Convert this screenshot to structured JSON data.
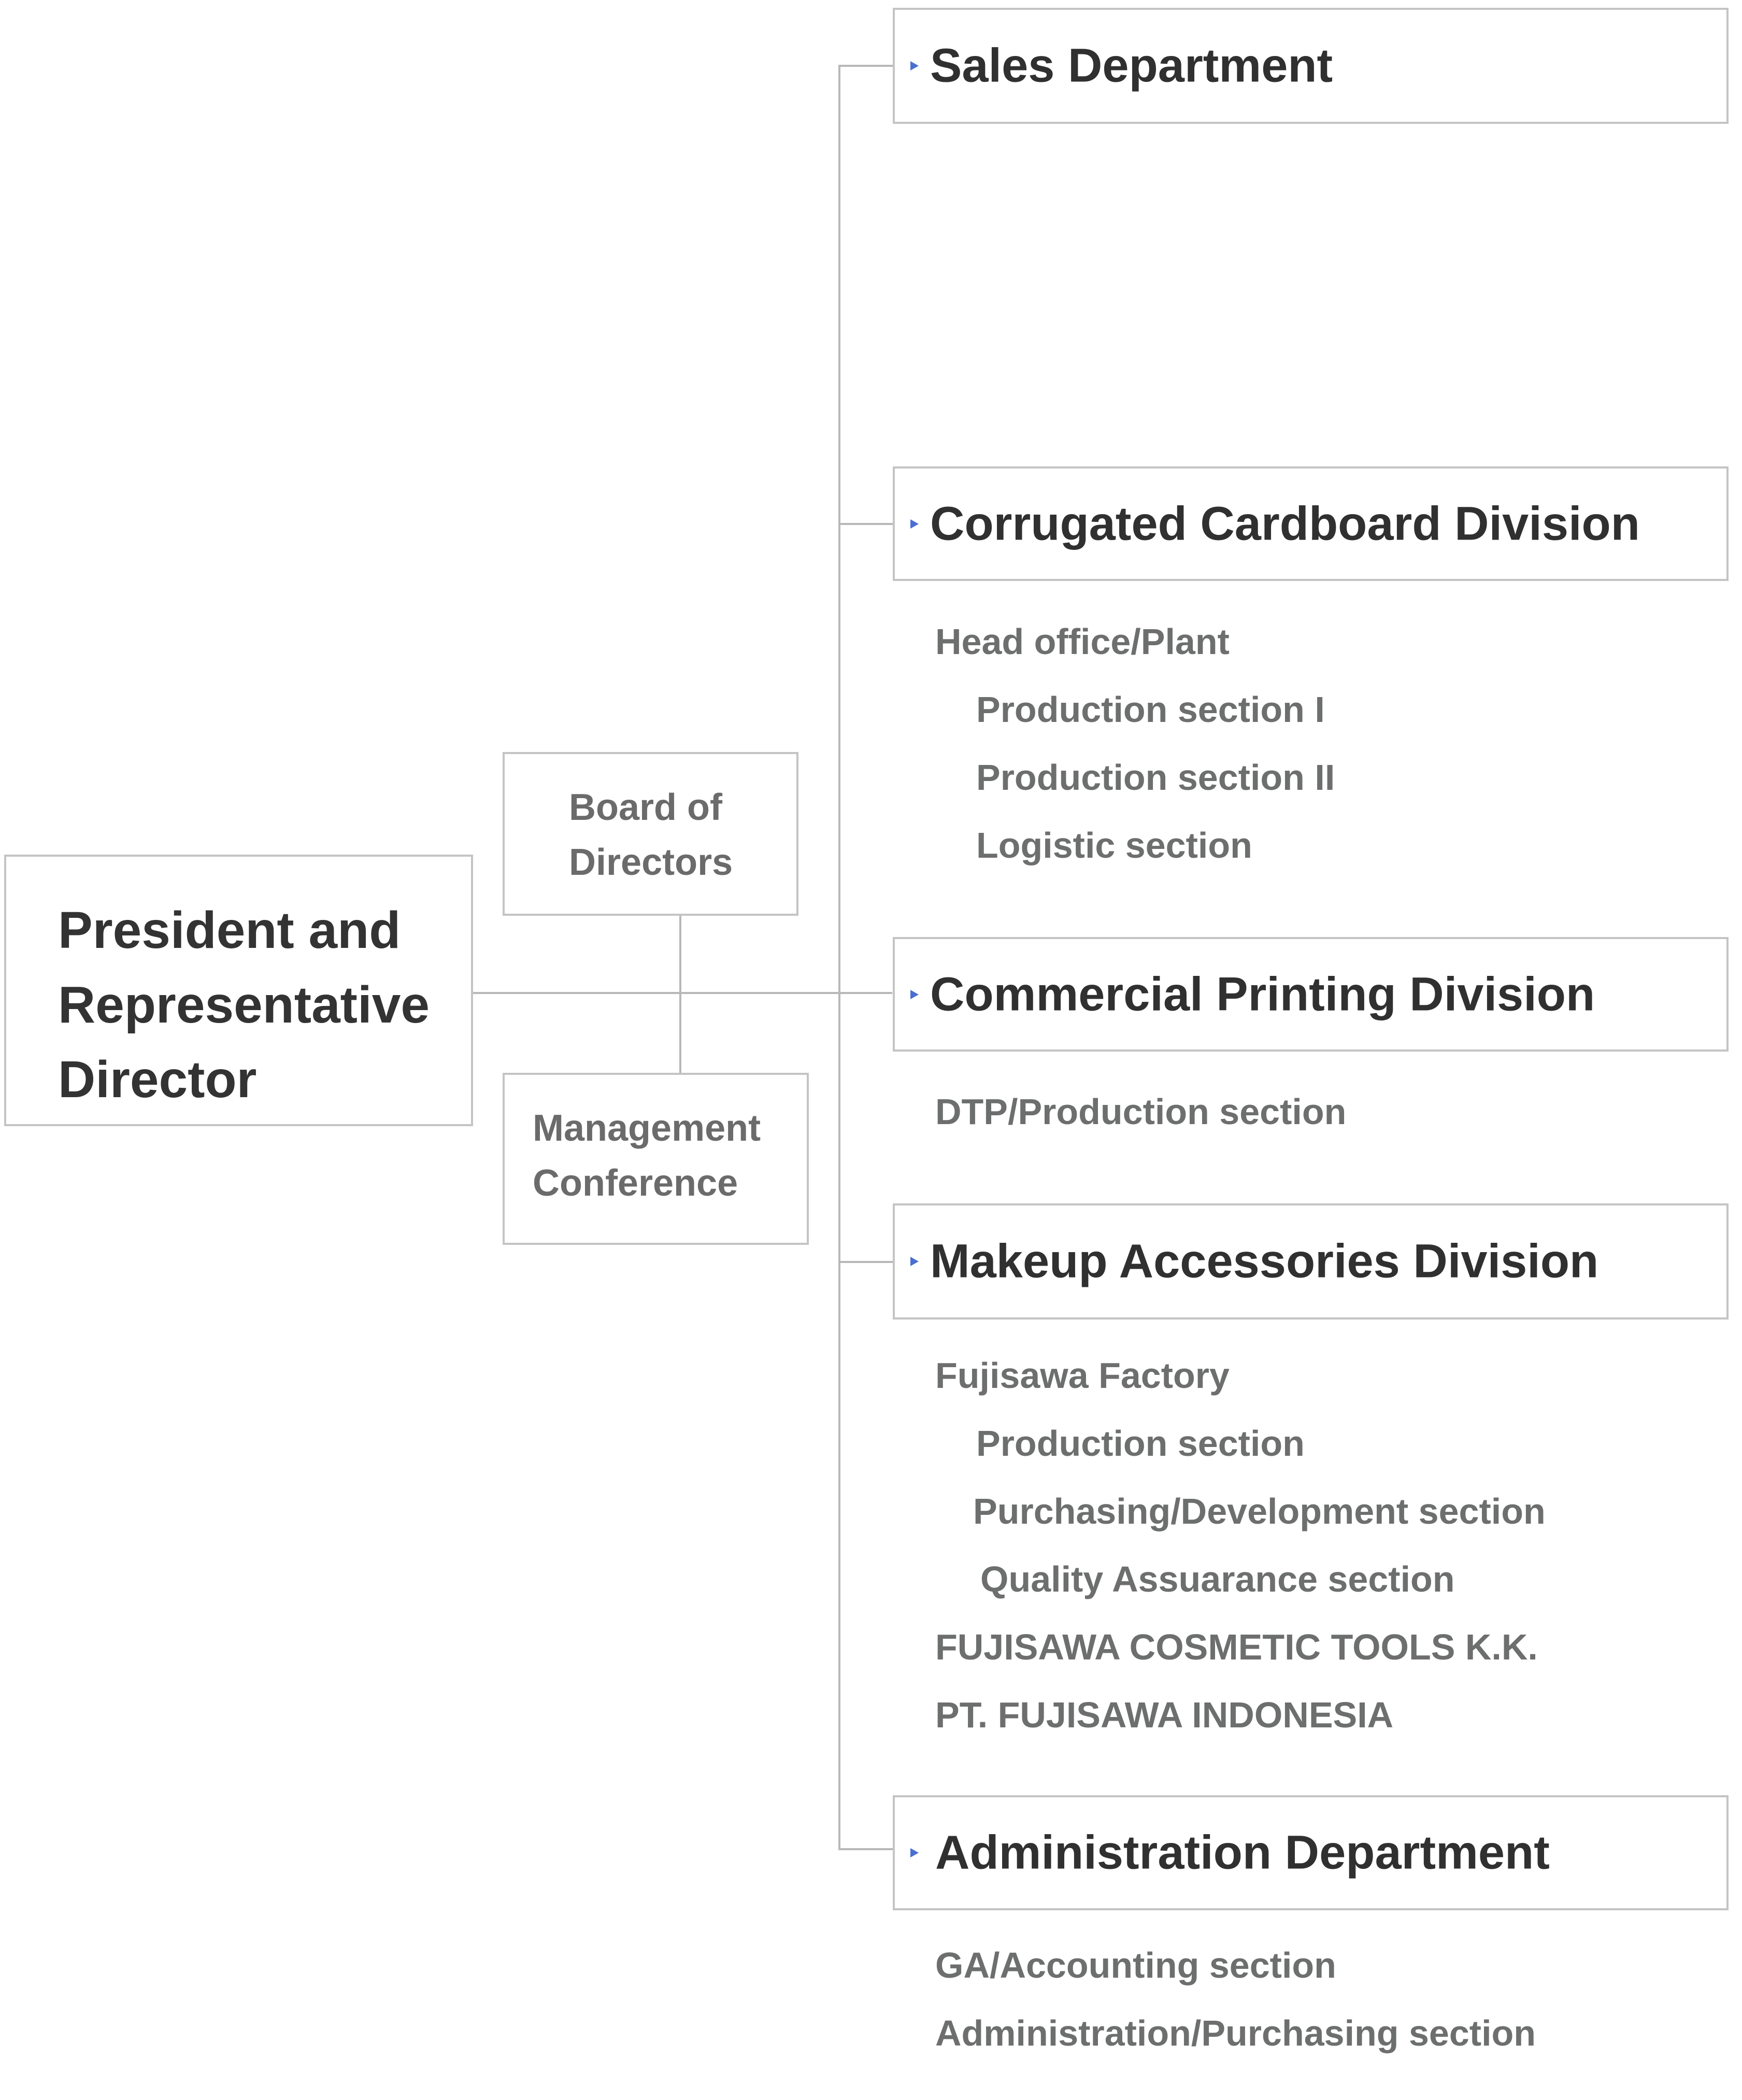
{
  "chart": {
    "president": {
      "label": "President and\nRepresentative\nDirector"
    },
    "board": {
      "label": "Board of\nDirectors"
    },
    "management": {
      "label": "Management\nConference"
    },
    "colors": {
      "line": "#b8b8b8",
      "border": "#c4c4c4",
      "title": "#303030",
      "subtext": "#6d6e6e",
      "arrow": "#4a6fd0"
    },
    "departments": [
      {
        "title": "Sales Department",
        "icon": "triangle-right-icon",
        "items": []
      },
      {
        "title": "Corrugated Cardboard Division",
        "icon": "triangle-right-icon",
        "items": [
          {
            "label": "Head office/Plant",
            "level": 0
          },
          {
            "label": "Production section I",
            "level": 1
          },
          {
            "label": "Production section II",
            "level": 1
          },
          {
            "label": "Logistic section",
            "level": 1
          }
        ]
      },
      {
        "title": "Commercial Printing Division",
        "icon": "triangle-right-icon",
        "items": [
          {
            "label": "DTP/Production section",
            "level": 0
          }
        ]
      },
      {
        "title": "Makeup Accessories Division",
        "icon": "triangle-right-icon",
        "items": [
          {
            "label": "Fujisawa Factory",
            "level": 0
          },
          {
            "label": "Production section",
            "level": 1
          },
          {
            "label": "Purchasing/Development section",
            "level": 1
          },
          {
            "label": "Quality Assuarance section",
            "level": 1
          },
          {
            "label": "FUJISAWA COSMETIC TOOLS K.K.",
            "level": 0
          },
          {
            "label": "PT. FUJISAWA INDONESIA",
            "level": 0
          }
        ]
      },
      {
        "title": "Administration Department",
        "icon": "triangle-right-icon",
        "items": [
          {
            "label": "GA/Accounting section",
            "level": 0
          },
          {
            "label": "Administration/Purchasing section",
            "level": 0
          }
        ]
      }
    ]
  }
}
